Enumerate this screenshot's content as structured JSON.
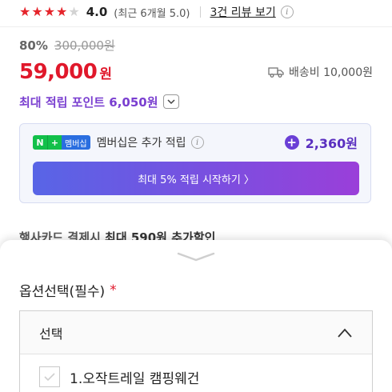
{
  "rating": {
    "stars_filled": 4,
    "stars_total": 5,
    "score": "4.0",
    "period": "(최근 6개월 5.0)",
    "review_link": "3건 리뷰 보기",
    "info_icon": "info-icon"
  },
  "pricing": {
    "discount": "80%",
    "original_price": "300,000원",
    "price": "59,000",
    "currency": "원",
    "shipping": "배송비 10,000원"
  },
  "points": {
    "label": "최대 적립 포인트 6,050원"
  },
  "membership": {
    "badge_n": "N",
    "badge_plus": "+",
    "badge_text": "멤버십",
    "text": "멤버십은 추가 적립",
    "points": "2,360원",
    "button": "최대 5% 적립 시작하기 〉"
  },
  "card_promo": {
    "prefix": "행사카드 결제시 ",
    "highlight": "최대 590원 추가할인"
  },
  "option_sheet": {
    "title": "옵션선택(필수)",
    "required_mark": "*",
    "select_label": "선택",
    "options": [
      {
        "label": "1.오작트레일 캠핑웨건"
      }
    ]
  },
  "colors": {
    "accent_red": "#e0182b",
    "accent_purple": "#7a3fd0",
    "star_red": "#e5242b"
  }
}
